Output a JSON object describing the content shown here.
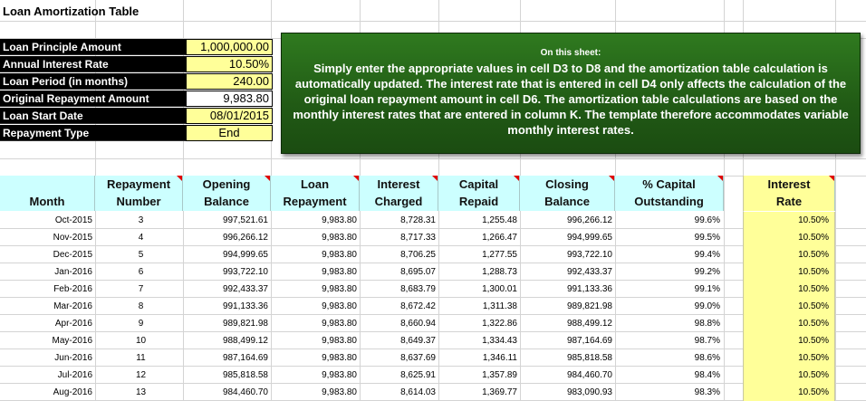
{
  "sheet": {
    "title": "Loan Amortization Table"
  },
  "inputs": [
    {
      "label": "Loan Principle Amount",
      "value": "1,000,000.00"
    },
    {
      "label": "Annual Interest Rate",
      "value": "10.50%"
    },
    {
      "label": "Loan Period (in months)",
      "value": "240.00"
    },
    {
      "label": "Original Repayment Amount",
      "value": "9,983.80"
    },
    {
      "label": "Loan Start Date",
      "value": "08/01/2015"
    },
    {
      "label": "Repayment Type",
      "value": "End"
    }
  ],
  "note": {
    "heading": "On this sheet:",
    "body": "Simply enter the appropriate values in cell D3 to D8 and the amortization table calculation is automatically updated. The interest rate that is entered in cell D4 only affects the calculation of the original loan repayment amount in cell D6. The amortization table calculations are based on the monthly interest rates that are entered in column K. The template therefore accommodates variable monthly interest rates."
  },
  "table": {
    "headers": {
      "month": "Month",
      "repayment_number": [
        "Repayment",
        "Number"
      ],
      "opening_balance": [
        "Opening",
        "Balance"
      ],
      "loan_repayment": [
        "Loan",
        "Repayment"
      ],
      "interest_charged": [
        "Interest",
        "Charged"
      ],
      "capital_repaid": [
        "Capital",
        "Repaid"
      ],
      "closing_balance": [
        "Closing",
        "Balance"
      ],
      "capital_outstanding": [
        "% Capital",
        "Outstanding"
      ],
      "interest_rate": [
        "Interest",
        "Rate"
      ]
    },
    "rows": [
      [
        "Oct-2015",
        "3",
        "997,521.61",
        "9,983.80",
        "8,728.31",
        "1,255.48",
        "996,266.12",
        "99.6%",
        "10.50%"
      ],
      [
        "Nov-2015",
        "4",
        "996,266.12",
        "9,983.80",
        "8,717.33",
        "1,266.47",
        "994,999.65",
        "99.5%",
        "10.50%"
      ],
      [
        "Dec-2015",
        "5",
        "994,999.65",
        "9,983.80",
        "8,706.25",
        "1,277.55",
        "993,722.10",
        "99.4%",
        "10.50%"
      ],
      [
        "Jan-2016",
        "6",
        "993,722.10",
        "9,983.80",
        "8,695.07",
        "1,288.73",
        "992,433.37",
        "99.2%",
        "10.50%"
      ],
      [
        "Feb-2016",
        "7",
        "992,433.37",
        "9,983.80",
        "8,683.79",
        "1,300.01",
        "991,133.36",
        "99.1%",
        "10.50%"
      ],
      [
        "Mar-2016",
        "8",
        "991,133.36",
        "9,983.80",
        "8,672.42",
        "1,311.38",
        "989,821.98",
        "99.0%",
        "10.50%"
      ],
      [
        "Apr-2016",
        "9",
        "989,821.98",
        "9,983.80",
        "8,660.94",
        "1,322.86",
        "988,499.12",
        "98.8%",
        "10.50%"
      ],
      [
        "May-2016",
        "10",
        "988,499.12",
        "9,983.80",
        "8,649.37",
        "1,334.43",
        "987,164.69",
        "98.7%",
        "10.50%"
      ],
      [
        "Jun-2016",
        "11",
        "987,164.69",
        "9,983.80",
        "8,637.69",
        "1,346.11",
        "985,818.58",
        "98.6%",
        "10.50%"
      ],
      [
        "Jul-2016",
        "12",
        "985,818.58",
        "9,983.80",
        "8,625.91",
        "1,357.89",
        "984,460.70",
        "98.4%",
        "10.50%"
      ],
      [
        "Aug-2016",
        "13",
        "984,460.70",
        "9,983.80",
        "8,614.03",
        "1,369.77",
        "983,090.93",
        "98.3%",
        "10.50%"
      ]
    ]
  },
  "colors": {
    "input_label_bg": "#000000",
    "input_value_bg": "#ffff99",
    "header_bg": "#ccffff",
    "note_bg": "#215a15",
    "comment_flag": "#e00000"
  }
}
